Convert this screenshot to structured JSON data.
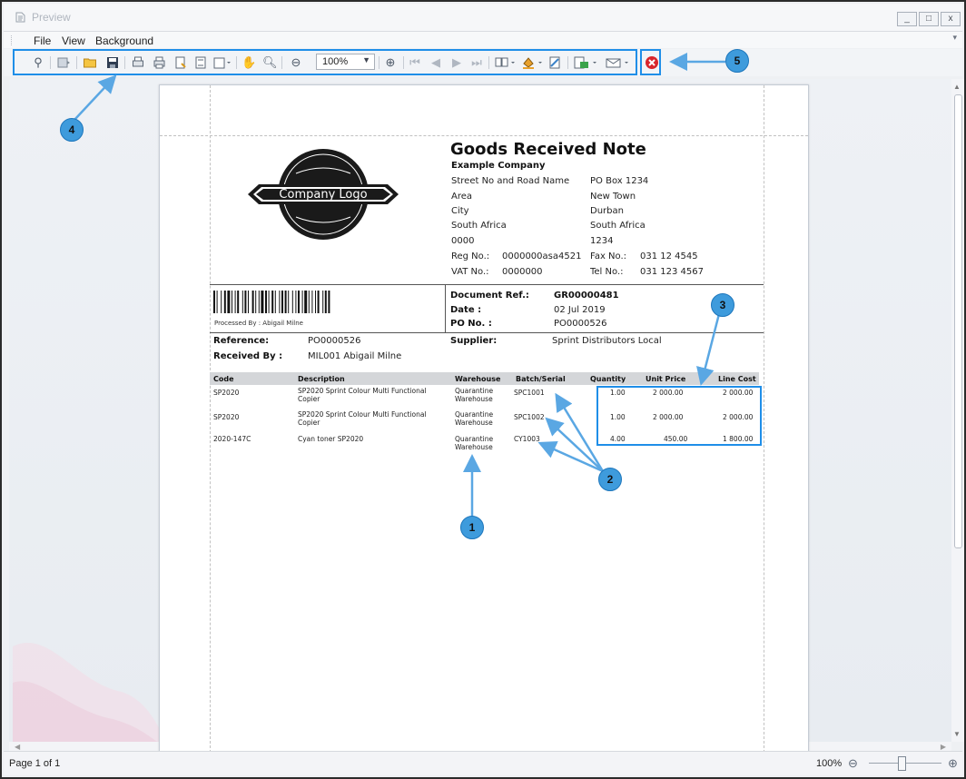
{
  "window": {
    "title": "Preview",
    "minimize": "_",
    "maximize": "□",
    "close": "x"
  },
  "menu": {
    "items": [
      "File",
      "View",
      "Background"
    ]
  },
  "toolbar": {
    "zoom_value": "100%"
  },
  "callouts": [
    "1",
    "2",
    "3",
    "4",
    "5"
  ],
  "report": {
    "title": "Goods Received Note",
    "company": "Example Company",
    "address_left": [
      "Street No and Road Name",
      "Area",
      "City",
      "South Africa",
      "0000"
    ],
    "address_right": [
      "PO Box 1234",
      "New Town",
      "Durban",
      "South Africa",
      "1234"
    ],
    "reg_label": "Reg No.:",
    "reg_value": "0000000asa4521",
    "vat_label": "VAT No.:",
    "vat_value": "0000000",
    "fax_label": "Fax No.:",
    "fax_value": "031 12 4545",
    "tel_label": "Tel No.:",
    "tel_value": "031 123 4567",
    "logo_text": "Company Logo",
    "processed_by": "Processed By : Abigail Milne",
    "doc_ref_label": "Document Ref.:",
    "doc_ref_value": "GR00000481",
    "date_label": "Date :",
    "date_value": "02 Jul 2019",
    "po_label": "PO No. :",
    "po_value": "PO0000526",
    "reference_label": "Reference:",
    "reference_value": "PO0000526",
    "received_label": "Received By :",
    "received_value": "MIL001 Abigail Milne",
    "supplier_label": "Supplier:",
    "supplier_value": "Sprint Distributors Local",
    "columns": [
      "Code",
      "Description",
      "Warehouse",
      "Batch/Serial",
      "Quantity",
      "Unit Price",
      "Line Cost"
    ],
    "rows": [
      {
        "code": "SP2020",
        "desc1": "SP2020 Sprint Colour Multi Functional",
        "desc2": "Copier",
        "wh1": "Quarantine",
        "wh2": "Warehouse",
        "batch": "SPC1001",
        "qty": "1.00",
        "price": "2 000.00",
        "cost": "2 000.00"
      },
      {
        "code": "SP2020",
        "desc1": "SP2020 Sprint Colour Multi Functional",
        "desc2": "Copier",
        "wh1": "Quarantine",
        "wh2": "Warehouse",
        "batch": "SPC1002",
        "qty": "1.00",
        "price": "2 000.00",
        "cost": "2 000.00"
      },
      {
        "code": "2020-147C",
        "desc1": "Cyan toner SP2020",
        "desc2": "",
        "wh1": "Quarantine",
        "wh2": "Warehouse",
        "batch": "CY1003",
        "qty": "4.00",
        "price": "450.00",
        "cost": "1 800.00"
      }
    ]
  },
  "status": {
    "page": "Page 1 of 1",
    "zoom": "100%",
    "minus": "⊖",
    "plus": "⊕"
  },
  "colors": {
    "callout": "#1f8ee8",
    "badge": "#3e9bdc",
    "close_red": "#d9262c"
  }
}
